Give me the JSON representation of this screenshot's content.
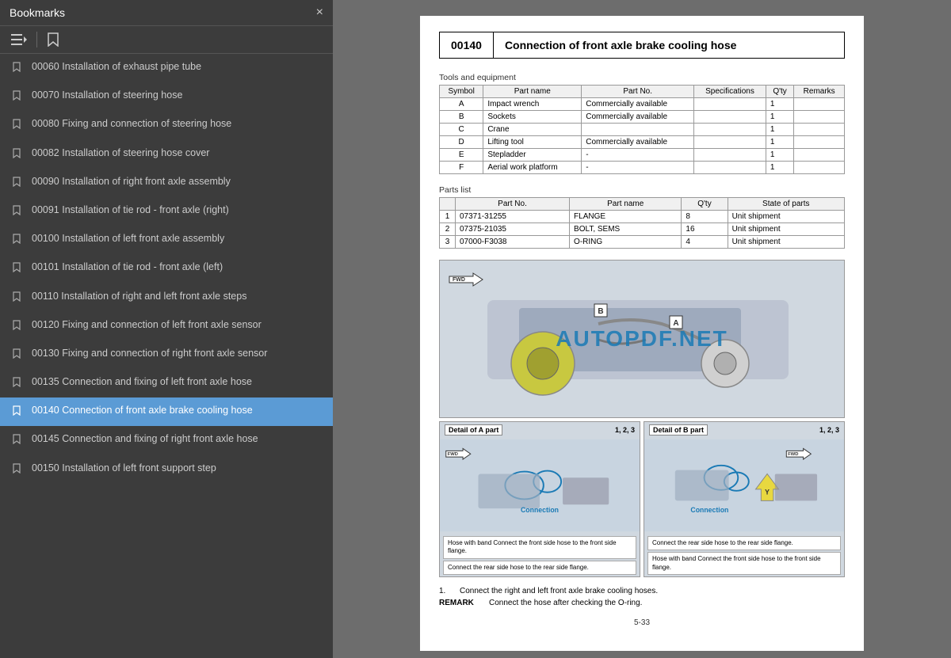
{
  "sidebar": {
    "title": "Bookmarks",
    "items": [
      {
        "id": "item-00060",
        "label": "00060 Installation of exhaust pipe tube",
        "active": false
      },
      {
        "id": "item-00070",
        "label": "00070 Installation of steering hose",
        "active": false
      },
      {
        "id": "item-00080",
        "label": "00080 Fixing and connection of steering hose",
        "active": false
      },
      {
        "id": "item-00082",
        "label": "00082 Installation of steering hose cover",
        "active": false
      },
      {
        "id": "item-00090",
        "label": "00090 Installation of right front axle assembly",
        "active": false
      },
      {
        "id": "item-00091",
        "label": "00091 Installation of tie rod - front axle (right)",
        "active": false
      },
      {
        "id": "item-00100",
        "label": "00100 Installation of left front axle assembly",
        "active": false
      },
      {
        "id": "item-00101",
        "label": "00101 Installation of tie rod - front axle (left)",
        "active": false
      },
      {
        "id": "item-00110",
        "label": "00110 Installation of right and left front axle steps",
        "active": false
      },
      {
        "id": "item-00120",
        "label": "00120 Fixing and connection of left front axle sensor",
        "active": false
      },
      {
        "id": "item-00130",
        "label": "00130 Fixing and connection of right front axle sensor",
        "active": false
      },
      {
        "id": "item-00135",
        "label": "00135 Connection and fixing of left front axle hose",
        "active": false
      },
      {
        "id": "item-00140",
        "label": "00140 Connection of front axle brake cooling hose",
        "active": true
      },
      {
        "id": "item-00145",
        "label": "00145 Connection and fixing of right front axle hose",
        "active": false
      },
      {
        "id": "item-00150",
        "label": "00150 Installation of left front support step",
        "active": false
      }
    ],
    "close_label": "×"
  },
  "toolbar": {
    "btn1_icon": "☰",
    "btn2_icon": "🔖"
  },
  "document": {
    "title_num": "00140",
    "title_text": "Connection of front axle brake cooling hose",
    "tools_section_label": "Tools and equipment",
    "tools_table": {
      "headers": [
        "Symbol",
        "Part name",
        "Part No.",
        "Specifications",
        "Q'ty",
        "Remarks"
      ],
      "rows": [
        [
          "A",
          "Impact wrench",
          "Commercially available",
          "",
          "1",
          ""
        ],
        [
          "B",
          "Sockets",
          "Commercially available",
          "",
          "1",
          ""
        ],
        [
          "C",
          "Crane",
          "",
          "",
          "1",
          ""
        ],
        [
          "D",
          "Lifting tool",
          "Commercially available",
          "",
          "1",
          ""
        ],
        [
          "E",
          "Stepladder",
          "-",
          "",
          "1",
          ""
        ],
        [
          "F",
          "Aerial work platform",
          "-",
          "",
          "1",
          ""
        ]
      ]
    },
    "parts_section_label": "Parts list",
    "parts_table": {
      "headers": [
        "",
        "Part No.",
        "Part name",
        "Q'ty",
        "State of parts"
      ],
      "rows": [
        [
          "1",
          "07371-31255",
          "FLANGE",
          "8",
          "Unit shipment"
        ],
        [
          "2",
          "07375-21035",
          "BOLT, SEMS",
          "16",
          "Unit shipment"
        ],
        [
          "3",
          "07000-F3038",
          "O-RING",
          "4",
          "Unit shipment"
        ]
      ]
    },
    "diagram": {
      "watermark": "AUTOPDF.NET",
      "main_fwd_label": "FWD",
      "label_a": "A",
      "label_b": "B",
      "detail_a": {
        "title": "Detail of A part",
        "badge": "1, 2, 3",
        "fwd_label": "FWD",
        "connection_label": "Connection",
        "callout1": "Hose with band\nConnect the front side hose to the front\nside flange.",
        "callout2": "Connect the rear side hose to the rear\nside flange."
      },
      "detail_b": {
        "title": "Detail of B part",
        "badge": "1, 2, 3",
        "fwd_label": "FWD",
        "connection_label": "Connection",
        "callout1": "Connect the rear side hose to the\nrear side flange.",
        "callout2": "Hose with band\nConnect the front side hose to the\nfront side flange."
      }
    },
    "remarks": [
      {
        "num": "1.",
        "text": "Connect the right and left front axle brake cooling hoses."
      },
      {
        "key": "REMARK",
        "text": "Connect the hose after checking the O-ring."
      }
    ],
    "page_num": "5-33"
  }
}
